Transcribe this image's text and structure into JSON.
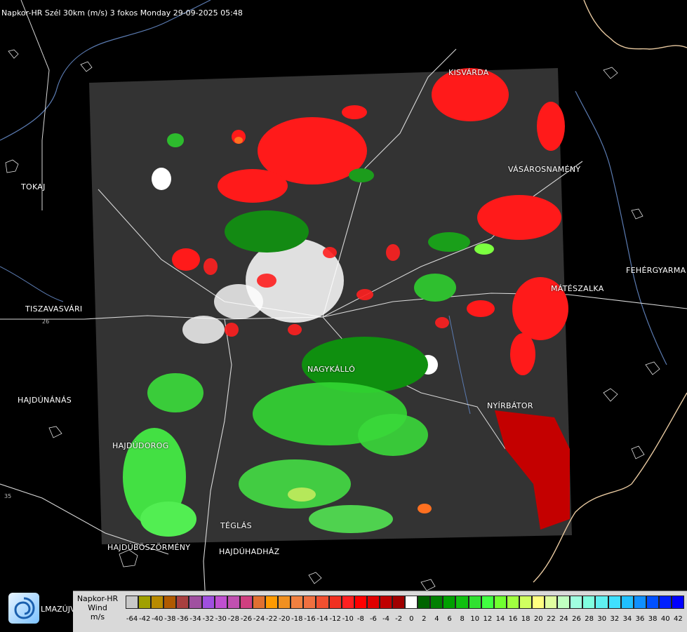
{
  "header": {
    "title": "Napkor-HR Szél 30km (m/s) 3 fokos Monday 29-09-2025 05:48"
  },
  "towns": {
    "kisvarda": "KISVÁRDA",
    "tokaj": "TOKAJ",
    "vasarosnameny": "VÁSÁROSNAMÉNY",
    "fehergyarmat": "FEHÉRGYARMA",
    "mateszalka": "MÁTÉSZALKA",
    "tiszavasvari": "TISZAVASVÁRI",
    "nagykallo": "NAGYKÁLLÓ",
    "hajdunanas": "HAJDÚNÁNÁS",
    "nyirbator": "NYÍRBÁTOR",
    "hajdudorog": "HAJDÚDOROG",
    "teglas": "TÉGLÁS",
    "hajduboszormeny": "HAJDÚBÖSZÖRMÉNY",
    "hajduhadhaz": "HAJDÚHADHÁZ",
    "hajdusamson_partial": "LMAZÚJVÁR"
  },
  "road_numbers": {
    "r26": "26",
    "r35": "35"
  },
  "legend": {
    "line1": "Napkor-HR",
    "line2": "Wind",
    "line3": "m/s",
    "ticks": [
      "-64",
      "-42",
      "-40",
      "-38",
      "-36",
      "-34",
      "-32",
      "-30",
      "-28",
      "-26",
      "-24",
      "-22",
      "-20",
      "-18",
      "-16",
      "-14",
      "-12",
      "-10",
      "-8",
      "-6",
      "-4",
      "-2",
      "0",
      "2",
      "4",
      "6",
      "8",
      "10",
      "12",
      "14",
      "16",
      "18",
      "20",
      "22",
      "24",
      "26",
      "28",
      "30",
      "32",
      "34",
      "36",
      "38",
      "40",
      "42"
    ],
    "colors": [
      "#c8c8c8",
      "#a0a000",
      "#b88a00",
      "#b05a00",
      "#a84040",
      "#a050a0",
      "#a050e0",
      "#c050d0",
      "#c050b0",
      "#d04080",
      "#e07030",
      "#ff9a00",
      "#f09020",
      "#f08040",
      "#f07040",
      "#f05030",
      "#f03020",
      "#ff2020",
      "#ff0000",
      "#e00000",
      "#c00000",
      "#a00000",
      "#ffffff",
      "#006400",
      "#008000",
      "#00a000",
      "#10c010",
      "#30e030",
      "#40ff40",
      "#70ff30",
      "#a0ff40",
      "#d0ff60",
      "#ffff80",
      "#e0ffa0",
      "#c0ffc0",
      "#a0ffe0",
      "#80ffe0",
      "#60f0f0",
      "#40e0ff",
      "#20c0ff",
      "#1090ff",
      "#0050ff",
      "#0020ff",
      "#0000ff"
    ]
  }
}
